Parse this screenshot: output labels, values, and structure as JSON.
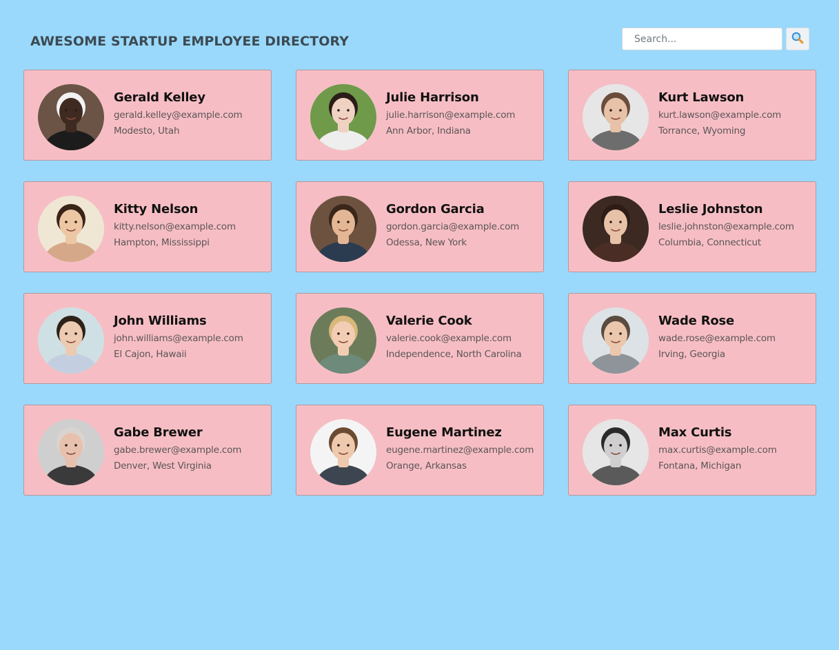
{
  "header": {
    "title": "AWESOME STARTUP EMPLOYEE DIRECTORY"
  },
  "search": {
    "placeholder": "Search...",
    "value": "",
    "button_icon": "magnifying-glass-icon"
  },
  "colors": {
    "page_background": "#9ad9fc",
    "card_background": "#f6bec4",
    "card_border": "#b2979c"
  },
  "employees": [
    {
      "name": "Gerald Kelley",
      "email": "gerald.kelley@example.com",
      "location": "Modesto, Utah",
      "photo": {
        "bg": "#6b5446",
        "skin": "#3e2a20",
        "hair": "#f2f2f2",
        "shirt": "#1c1c1c"
      }
    },
    {
      "name": "Julie Harrison",
      "email": "julie.harrison@example.com",
      "location": "Ann Arbor, Indiana",
      "photo": {
        "bg": "#6f9a4a",
        "skin": "#f0d2c2",
        "hair": "#2a1d17",
        "shirt": "#eeeeee"
      }
    },
    {
      "name": "Kurt Lawson",
      "email": "kurt.lawson@example.com",
      "location": "Torrance, Wyoming",
      "photo": {
        "bg": "#e6e6e6",
        "skin": "#e7c2a8",
        "hair": "#6a4e3b",
        "shirt": "#6d6d6d"
      }
    },
    {
      "name": "Kitty Nelson",
      "email": "kitty.nelson@example.com",
      "location": "Hampton, Mississippi",
      "photo": {
        "bg": "#f0e6d4",
        "skin": "#edc7a4",
        "hair": "#3a2418",
        "shirt": "#d6a88a"
      }
    },
    {
      "name": "Gordon Garcia",
      "email": "gordon.garcia@example.com",
      "location": "Odessa, New York",
      "photo": {
        "bg": "#6e5240",
        "skin": "#e3b796",
        "hair": "#3b2719",
        "shirt": "#2c3c50"
      }
    },
    {
      "name": "Leslie Johnston",
      "email": "leslie.johnston@example.com",
      "location": "Columbia, Connecticut",
      "photo": {
        "bg": "#3c2a22",
        "skin": "#e8c2a8",
        "hair": "#2e1d16",
        "shirt": "#4a2e26"
      }
    },
    {
      "name": "John Williams",
      "email": "john.williams@example.com",
      "location": "El Cajon, Hawaii",
      "photo": {
        "bg": "#cfe0e4",
        "skin": "#eccbb2",
        "hair": "#2e2118",
        "shirt": "#c3cfe0"
      }
    },
    {
      "name": "Valerie Cook",
      "email": "valerie.cook@example.com",
      "location": "Independence, North Carolina",
      "photo": {
        "bg": "#6c7c5a",
        "skin": "#f2cdb4",
        "hair": "#d9b77a",
        "shirt": "#6d8a7a"
      }
    },
    {
      "name": "Wade Rose",
      "email": "wade.rose@example.com",
      "location": "Irving, Georgia",
      "photo": {
        "bg": "#dde2e6",
        "skin": "#eac7ad",
        "hair": "#5b4a3f",
        "shirt": "#8e949a"
      }
    },
    {
      "name": "Gabe Brewer",
      "email": "gabe.brewer@example.com",
      "location": "Denver, West Virginia",
      "photo": {
        "bg": "#cfcfcf",
        "skin": "#e8c0ae",
        "hair": "#d9d4cf",
        "shirt": "#3a3a3a"
      }
    },
    {
      "name": "Eugene Martinez",
      "email": "eugene.martinez@example.com",
      "location": "Orange, Arkansas",
      "photo": {
        "bg": "#f4f4f4",
        "skin": "#efc9ae",
        "hair": "#6b4a32",
        "shirt": "#3d4650"
      }
    },
    {
      "name": "Max Curtis",
      "email": "max.curtis@example.com",
      "location": "Fontana, Michigan",
      "photo": {
        "bg": "#e6e6e6",
        "skin": "#cfcfcf",
        "hair": "#2a2a2a",
        "shirt": "#5a5a5a"
      }
    }
  ]
}
